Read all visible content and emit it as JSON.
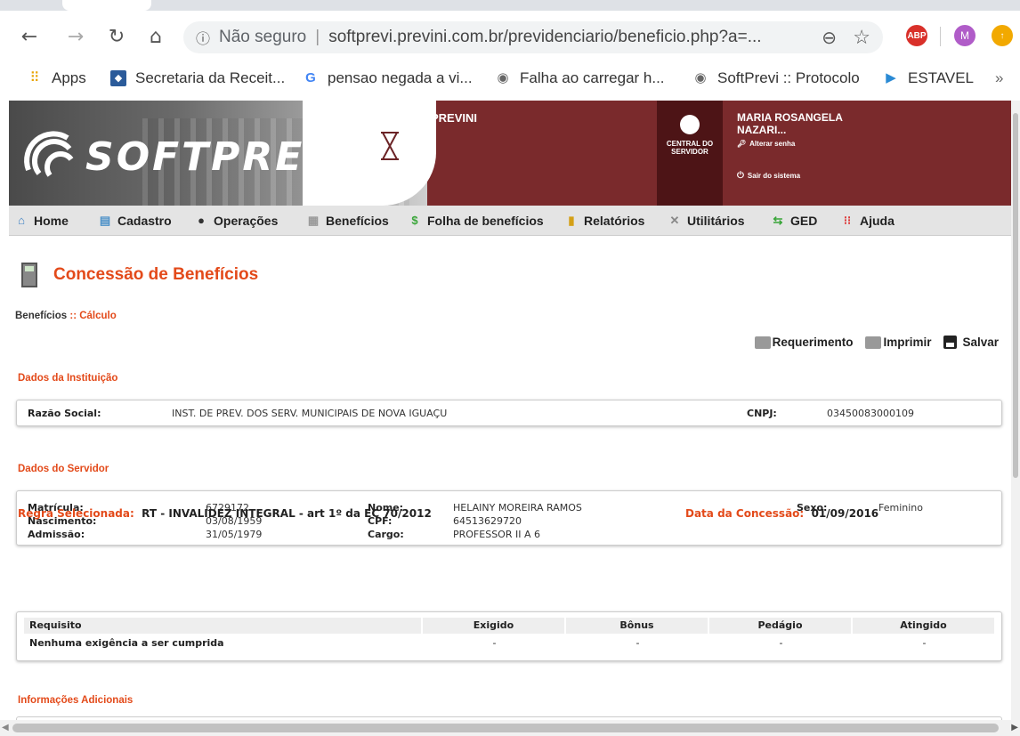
{
  "browser": {
    "back_icon": "arrow-left-icon",
    "forward_icon": "arrow-right-icon",
    "reload_icon": "reload-icon",
    "home_icon": "home-icon",
    "security_label": "Não seguro",
    "url": "softprevi.previni.com.br/previdenciario/beneficio.php?a=...",
    "extensions": {
      "abp": "ABP",
      "profile": "M"
    }
  },
  "bookmarks": [
    {
      "label": "Apps",
      "icon": "apps-grid-icon"
    },
    {
      "label": "Secretaria da Receit...",
      "icon": "receita-icon"
    },
    {
      "label": "pensao negada a vi...",
      "icon": "google-icon"
    },
    {
      "label": "Falha ao carregar h...",
      "icon": "globe-icon"
    },
    {
      "label": "SoftPrevi :: Protocolo",
      "icon": "globe-icon"
    },
    {
      "label": "ESTAVEL",
      "icon": "estavel-icon"
    }
  ],
  "bookmarks_overflow": "»",
  "header": {
    "logo_text": "SOFTPREVI",
    "org": "PREVINI",
    "central_line1": "CENTRAL DO",
    "central_line2": "SERVIDOR",
    "user_line1": "MARIA ROSANGELA",
    "user_line2": "NAZARI...",
    "change_password": "Alterar senha",
    "logout": "Sair do sistema"
  },
  "menu": [
    {
      "label": "Home",
      "icon": "home-icon"
    },
    {
      "label": "Cadastro",
      "icon": "cadastro-icon"
    },
    {
      "label": "Operações",
      "icon": "operacoes-icon"
    },
    {
      "label": "Benefícios",
      "icon": "beneficios-icon"
    },
    {
      "label": "Folha de benefícios",
      "icon": "money-icon"
    },
    {
      "label": "Relatórios",
      "icon": "chart-icon"
    },
    {
      "label": "Utilitários",
      "icon": "tools-icon"
    },
    {
      "label": "GED",
      "icon": "ged-icon"
    },
    {
      "label": "Ajuda",
      "icon": "help-icon"
    }
  ],
  "page": {
    "title": "Concessão de Benefícios",
    "crumb_parent": "Benefícios",
    "crumb_sep": " :: ",
    "crumb_current": "Cálculo",
    "actions": {
      "requerimento": "Requerimento",
      "imprimir": "Imprimir",
      "salvar": "Salvar"
    }
  },
  "instituicao": {
    "section_title": "Dados da Instituição",
    "razao_label": "Razão Social:",
    "razao_value": "INST. DE PREV. DOS SERV. MUNICIPAIS DE NOVA IGUAÇU",
    "cnpj_label": "CNPJ:",
    "cnpj_value": "03450083000109"
  },
  "servidor": {
    "section_title": "Dados do Servidor",
    "matricula_label": "Matrícula:",
    "matricula_value": "6729172",
    "nascimento_label": "Nascimento:",
    "nascimento_value": "03/08/1959",
    "admissao_label": "Admissão:",
    "admissao_value": "31/05/1979",
    "nome_label": "Nome:",
    "nome_value": "HELAINY MOREIRA RAMOS",
    "cpf_label": "CPF:",
    "cpf_value": "64513629720",
    "cargo_label": "Cargo:",
    "cargo_value": "PROFESSOR II A 6",
    "sexo_label": "Sexo:",
    "sexo_value": "Feminino"
  },
  "regra": {
    "label": "Regra Selecionada:",
    "value": "RT - INVALIDEZ INTEGRAL - art 1º da EC 70/2012",
    "data_label": "Data da Concessão:",
    "data_value": "01/09/2016"
  },
  "requisitos": {
    "headers": [
      "Requisito",
      "Exigido",
      "Bônus",
      "Pedágio",
      "Atingido"
    ],
    "row": [
      "Nenhuma exigência a ser cumprida",
      "-",
      "-",
      "-",
      "-"
    ]
  },
  "adicionais": {
    "section_title": "Informações Adicionais"
  },
  "colors": {
    "accent": "#e34a1a",
    "banner": "#7a2a2c",
    "central": "#4d1416"
  }
}
